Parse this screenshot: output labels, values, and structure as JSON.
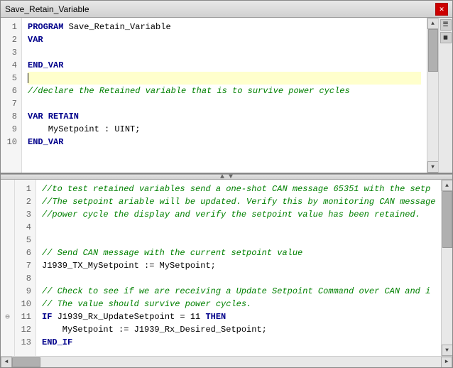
{
  "window": {
    "title": "Save_Retain_Variable",
    "close_label": "✕"
  },
  "top_pane": {
    "lines": [
      {
        "num": 1,
        "code": "PROGRAM Save_Retain_Variable",
        "highlight": false
      },
      {
        "num": 2,
        "code": "VAR",
        "highlight": false
      },
      {
        "num": 3,
        "code": "",
        "highlight": false
      },
      {
        "num": 4,
        "code": "END_VAR",
        "highlight": false
      },
      {
        "num": 5,
        "code": "",
        "highlight": true
      },
      {
        "num": 6,
        "code": "//declare the Retained variable that is to survive power cycles",
        "highlight": false
      },
      {
        "num": 7,
        "code": "",
        "highlight": false
      },
      {
        "num": 8,
        "code": "VAR RETAIN",
        "highlight": false
      },
      {
        "num": 9,
        "code": "    MySetpoint : UINT;",
        "highlight": false
      },
      {
        "num": 10,
        "code": "END_VAR",
        "highlight": false
      }
    ]
  },
  "bottom_pane": {
    "lines": [
      {
        "num": 1,
        "code": "//to test retained variables send a one-shot CAN message 65351 with the setp",
        "highlight": false
      },
      {
        "num": 2,
        "code": "//The setpoint ariable will be updated. Verify this by monitoring CAN message",
        "highlight": false
      },
      {
        "num": 3,
        "code": "//power cycle the display and verify the setpoint value has been retained.",
        "highlight": false
      },
      {
        "num": 4,
        "code": "",
        "highlight": false
      },
      {
        "num": 5,
        "code": "",
        "highlight": false
      },
      {
        "num": 6,
        "code": "// Send CAN message with the current setpoint value",
        "highlight": false
      },
      {
        "num": 7,
        "code": "J1939_TX_MySetpoint := MySetpoint;",
        "highlight": false
      },
      {
        "num": 8,
        "code": "",
        "highlight": false
      },
      {
        "num": 9,
        "code": "// Check to see if we are receiving a Update Setpoint Command over CAN and i",
        "highlight": false
      },
      {
        "num": 10,
        "code": "// The value should survive power cycles.",
        "highlight": false
      },
      {
        "num": 11,
        "code": "IF J1939_Rx_UpdateSetpoint = 11 THEN",
        "highlight": false
      },
      {
        "num": 12,
        "code": "    MySetpoint := J1939_Rx_Desired_Setpoint;",
        "highlight": false
      },
      {
        "num": 13,
        "code": "END_IF",
        "highlight": false
      }
    ]
  },
  "splitter": {
    "arrows": "▲ ▼"
  }
}
